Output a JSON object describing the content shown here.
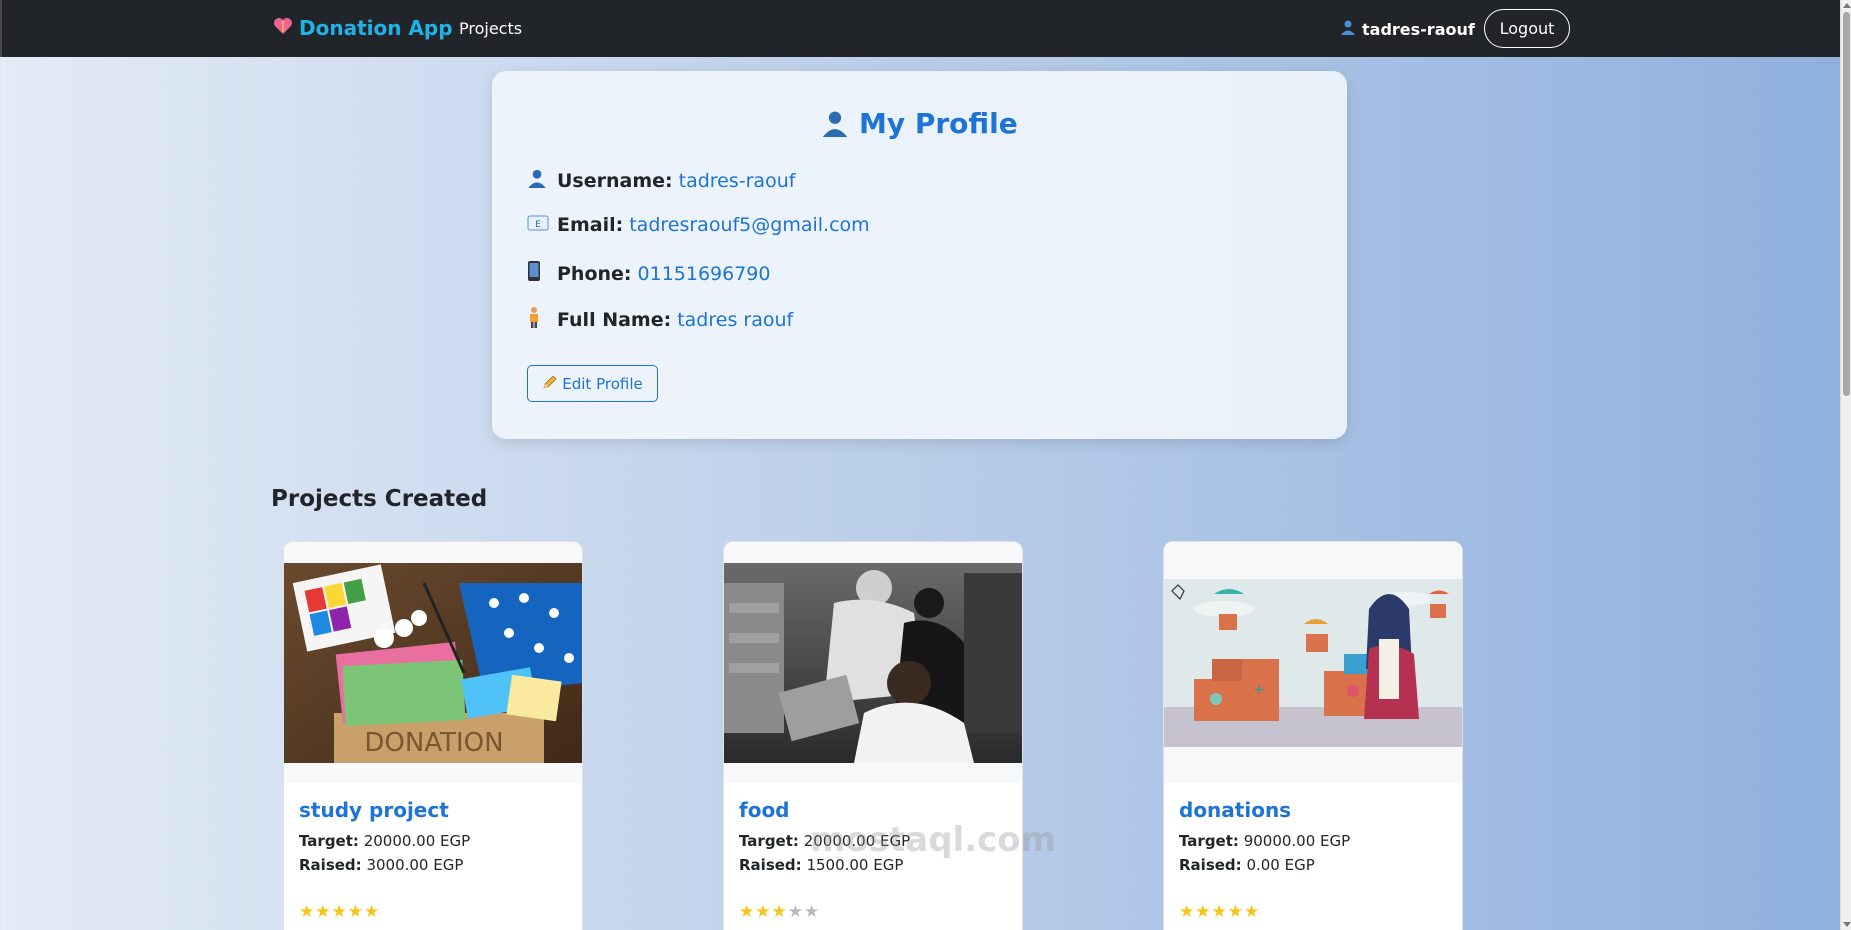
{
  "navbar": {
    "brand": "Donation App",
    "brand_icon": "heart-icon",
    "projects_link": "Projects",
    "username": "tadres-raouf",
    "logout": "Logout"
  },
  "profile": {
    "title": "My Profile",
    "fields": [
      {
        "label": "Username:",
        "value": "tadres-raouf",
        "icon": "user-icon"
      },
      {
        "label": "Email:",
        "value": "tadresraouf5@gmail.com",
        "icon": "email-icon"
      },
      {
        "label": "Phone:",
        "value": "01151696790",
        "icon": "phone-icon"
      },
      {
        "label": "Full Name:",
        "value": "tadres raouf",
        "icon": "person-icon"
      }
    ],
    "edit_button": "Edit Profile"
  },
  "section_title": "Projects Created",
  "projects": [
    {
      "title": "study project",
      "target_label": "Target:",
      "target": "20000.00 EGP",
      "raised_label": "Raised:",
      "raised": "3000.00 EGP",
      "rating": 5
    },
    {
      "title": "food",
      "target_label": "Target:",
      "target": "20000.00 EGP",
      "raised_label": "Raised:",
      "raised": "1500.00 EGP",
      "rating": 3
    },
    {
      "title": "donations",
      "target_label": "Target:",
      "target": "90000.00 EGP",
      "raised_label": "Raised:",
      "raised": "0.00 EGP",
      "rating": 5
    }
  ],
  "watermark": "mostaql.com",
  "colors": {
    "accent": "#1d73d6",
    "brand": "#1fb2e6",
    "navbar": "#212529",
    "star": "#f5c518"
  }
}
